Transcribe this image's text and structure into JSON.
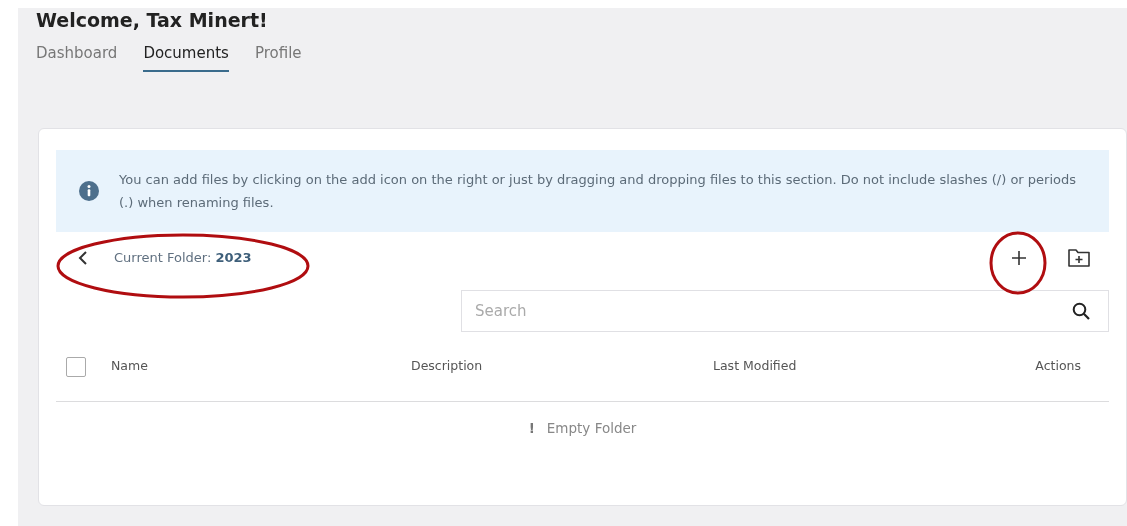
{
  "heading": "Welcome, Tax Minert!",
  "tabs": [
    {
      "label": "Dashboard",
      "selected": false
    },
    {
      "label": "Documents",
      "selected": true
    },
    {
      "label": "Profile",
      "selected": false
    }
  ],
  "info_alert": {
    "text": "You can add files by clicking on the add icon on the right or just by dragging and dropping files to this section. Do not include slashes (/) or periods (.) when renaming files."
  },
  "folder": {
    "label": "Current Folder: **2023**"
  },
  "search": {
    "placeholder": "Search"
  },
  "table": {
    "select_all_checked": false,
    "columns": [
      "Name",
      "Description",
      "Last Modified",
      "Actions"
    ],
    "empty_message": "Empty Folder",
    "empty_icon": "!"
  }
}
